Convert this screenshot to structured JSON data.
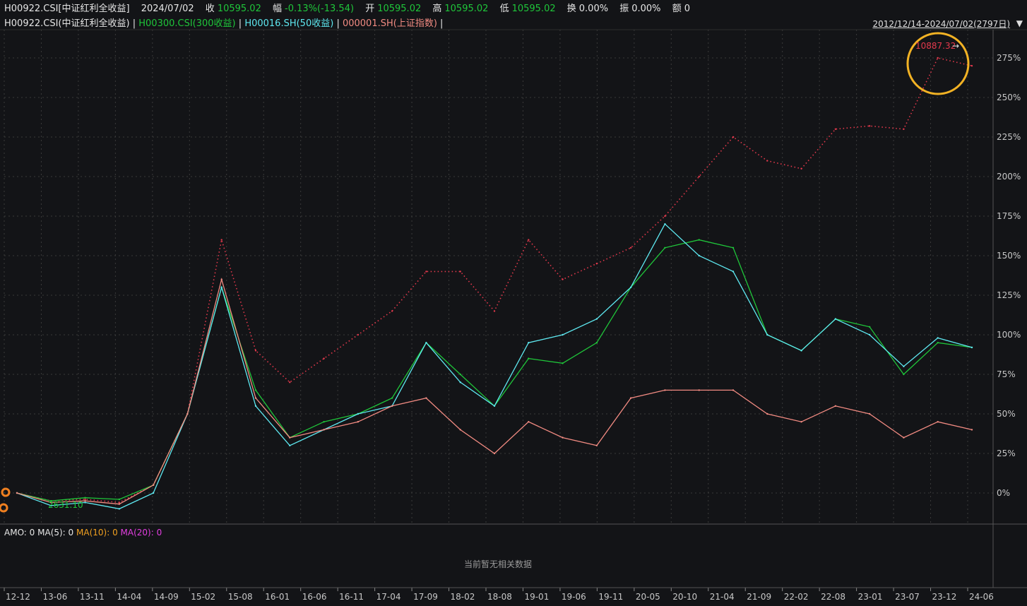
{
  "header": {
    "code": "H00922.CSI[中证红利全收益]",
    "date": "2024/07/02",
    "close_label": "收",
    "close_value": "10595.02",
    "change_label": "幅",
    "change_value": "-0.13%(-13.54)",
    "open_label": "开",
    "open_value": "10595.02",
    "high_label": "高",
    "high_value": "10595.02",
    "low_label": "低",
    "low_value": "10595.02",
    "turnover_label": "换",
    "turnover_value": "0.00%",
    "amplitude_label": "振",
    "amplitude_value": "0.00%",
    "amount_label": "额",
    "amount_value": "0"
  },
  "legend": {
    "items": [
      {
        "text": "H00922.CSI(中证红利全收益)",
        "color": "#e6e6e6"
      },
      {
        "text": "H00300.CSI(300收益)",
        "color": "#1fc63a"
      },
      {
        "text": "H00016.SH(50收益)",
        "color": "#5ee8f0"
      },
      {
        "text": "000001.SH(上证指数)",
        "color": "#f28b82"
      }
    ],
    "separator": "|",
    "range": "2012/12/14-2024/07/02(2797日)"
  },
  "annotations": {
    "max_label": "10887.32",
    "min_label": "2631.10"
  },
  "volume": {
    "amo": "AMO: 0",
    "ma5": "MA(5): 0",
    "ma10": "MA(10): 0",
    "ma20": "MA(20): 0",
    "colors": {
      "ma10": "#f0a020",
      "ma20": "#e23ee0"
    },
    "empty_text": "当前暂无相关数据"
  },
  "colors": {
    "dividend": "#e4394c",
    "hs300": "#1fc63a",
    "sz50": "#5ee8f0",
    "shanghai": "#f28b82",
    "highlight": "#f2b224",
    "grid": "#3a3a3a"
  },
  "chart_data": {
    "type": "line",
    "title": "",
    "xlabel": "",
    "ylabel": "",
    "y_unit": "%",
    "ylim": [
      -15,
      285
    ],
    "y_ticks": [
      "0%",
      "25%",
      "50%",
      "75%",
      "100%",
      "125%",
      "150%",
      "175%",
      "200%",
      "225%",
      "250%",
      "275%"
    ],
    "x_ticks": [
      "12-12",
      "13-06",
      "13-11",
      "14-04",
      "14-09",
      "15-02",
      "15-08",
      "16-01",
      "16-06",
      "16-11",
      "17-04",
      "17-09",
      "18-02",
      "18-08",
      "19-01",
      "19-06",
      "19-11",
      "20-05",
      "20-10",
      "21-04",
      "21-09",
      "22-02",
      "22-08",
      "23-01",
      "23-07",
      "23-12",
      "24-06"
    ],
    "x": [
      "12-12",
      "13-06",
      "13-11",
      "14-04",
      "14-09",
      "15-02",
      "15-06",
      "15-08",
      "16-01",
      "16-06",
      "16-11",
      "17-04",
      "17-09",
      "18-02",
      "18-08",
      "19-01",
      "19-06",
      "19-11",
      "20-05",
      "20-10",
      "21-04",
      "21-09",
      "22-02",
      "22-08",
      "23-01",
      "23-07",
      "23-12",
      "24-06",
      "24-07"
    ],
    "series": [
      {
        "name": "H00922.CSI(中证红利全收益)",
        "style": "dotted",
        "values": [
          0,
          -5,
          -4,
          -6,
          5,
          50,
          160,
          90,
          70,
          85,
          100,
          115,
          140,
          140,
          115,
          160,
          135,
          145,
          155,
          175,
          200,
          225,
          210,
          205,
          230,
          232,
          230,
          275,
          270
        ]
      },
      {
        "name": "H00300.CSI(300收益)",
        "values": [
          0,
          -5,
          -3,
          -4,
          5,
          50,
          130,
          65,
          35,
          45,
          50,
          60,
          95,
          75,
          55,
          85,
          82,
          95,
          130,
          155,
          160,
          155,
          100,
          90,
          110,
          105,
          75,
          95,
          92
        ]
      },
      {
        "name": "H00016.SH(50收益)",
        "values": [
          0,
          -8,
          -6,
          -10,
          0,
          50,
          130,
          55,
          30,
          40,
          50,
          55,
          95,
          70,
          55,
          95,
          100,
          110,
          130,
          170,
          150,
          140,
          100,
          90,
          110,
          100,
          80,
          98,
          92
        ]
      },
      {
        "name": "000001.SH(上证指数)",
        "values": [
          0,
          -6,
          -5,
          -7,
          5,
          50,
          135,
          60,
          35,
          40,
          45,
          55,
          60,
          40,
          25,
          45,
          35,
          30,
          60,
          65,
          65,
          65,
          50,
          45,
          55,
          50,
          35,
          45,
          40
        ]
      }
    ]
  }
}
